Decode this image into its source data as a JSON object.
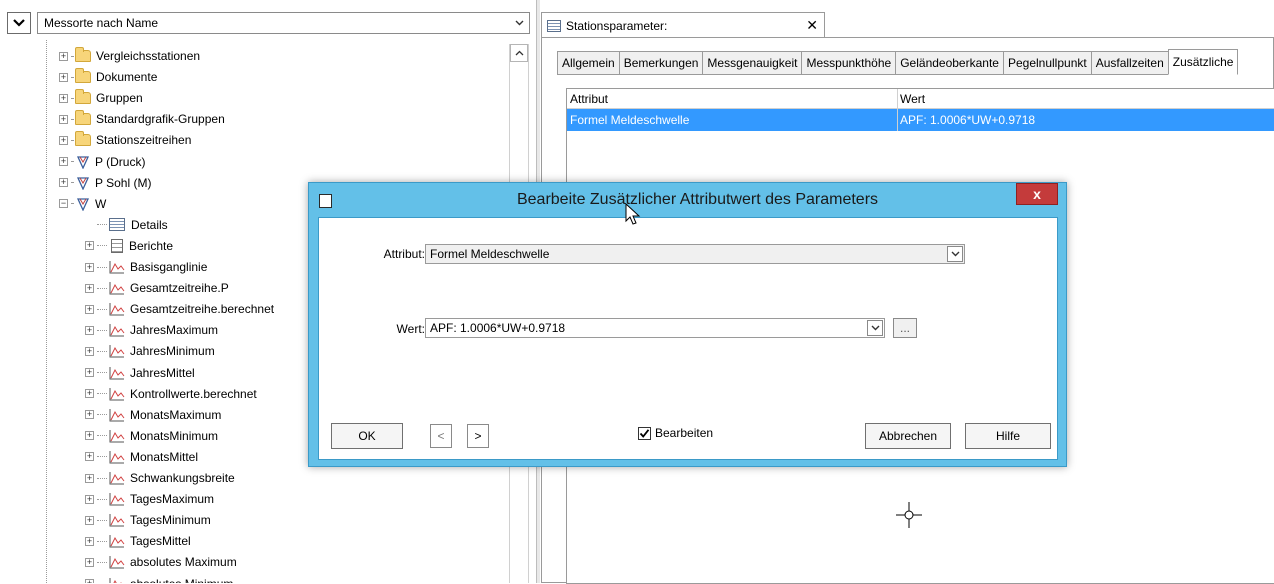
{
  "tree_view": {
    "selector_value": "Messorte nach Name",
    "items": [
      {
        "label": "Vergleichsstationen",
        "type": "folder",
        "level": 0,
        "expander": "+"
      },
      {
        "label": "Dokumente",
        "type": "folder",
        "level": 0,
        "expander": "+"
      },
      {
        "label": "Gruppen",
        "type": "folder",
        "level": 0,
        "expander": "+"
      },
      {
        "label": "Standardgrafik-Gruppen",
        "type": "folder",
        "level": 0,
        "expander": "+"
      },
      {
        "label": "Stationszeitreihen",
        "type": "folder",
        "level": 0,
        "expander": "+"
      },
      {
        "label": "P (Druck)",
        "type": "parameter",
        "level": 0,
        "expander": "+"
      },
      {
        "label": "P Sohl (M)",
        "type": "parameter",
        "level": 0,
        "expander": "+"
      },
      {
        "label": "W",
        "type": "parameter",
        "level": 0,
        "expander": "-"
      },
      {
        "label": "Details",
        "type": "table",
        "level": 1,
        "expander": ""
      },
      {
        "label": "Berichte",
        "type": "document",
        "level": 1,
        "expander": "+"
      },
      {
        "label": "Basisganglinie",
        "type": "timeseries",
        "level": 1,
        "expander": "+"
      },
      {
        "label": "Gesamtzeitreihe.P",
        "type": "timeseries",
        "level": 1,
        "expander": "+"
      },
      {
        "label": "Gesamtzeitreihe.berechnet",
        "type": "timeseries",
        "level": 1,
        "expander": "+"
      },
      {
        "label": "JahresMaximum",
        "type": "timeseries",
        "level": 1,
        "expander": "+"
      },
      {
        "label": "JahresMinimum",
        "type": "timeseries",
        "level": 1,
        "expander": "+"
      },
      {
        "label": "JahresMittel",
        "type": "timeseries",
        "level": 1,
        "expander": "+"
      },
      {
        "label": "Kontrollwerte.berechnet",
        "type": "timeseries",
        "level": 1,
        "expander": "+"
      },
      {
        "label": "MonatsMaximum",
        "type": "timeseries",
        "level": 1,
        "expander": "+"
      },
      {
        "label": "MonatsMinimum",
        "type": "timeseries",
        "level": 1,
        "expander": "+"
      },
      {
        "label": "MonatsMittel",
        "type": "timeseries",
        "level": 1,
        "expander": "+"
      },
      {
        "label": "Schwankungsbreite",
        "type": "timeseries",
        "level": 1,
        "expander": "+"
      },
      {
        "label": "TagesMaximum",
        "type": "timeseries",
        "level": 1,
        "expander": "+"
      },
      {
        "label": "TagesMinimum",
        "type": "timeseries",
        "level": 1,
        "expander": "+"
      },
      {
        "label": "TagesMittel",
        "type": "timeseries",
        "level": 1,
        "expander": "+"
      },
      {
        "label": "absolutes Maximum",
        "type": "timeseries",
        "level": 1,
        "expander": "+"
      },
      {
        "label": "absolutes Minimum",
        "type": "timeseries",
        "level": 1,
        "expander": "+"
      }
    ]
  },
  "station_panel": {
    "doc_tab_title": "Stationsparameter:",
    "tabs": [
      {
        "label": "Allgemein",
        "active": false
      },
      {
        "label": "Bemerkungen",
        "active": false
      },
      {
        "label": "Messgenauigkeit",
        "active": false
      },
      {
        "label": "Messpunkthöhe",
        "active": false
      },
      {
        "label": "Geländeoberkante",
        "active": false
      },
      {
        "label": "Pegelnullpunkt",
        "active": false
      },
      {
        "label": "Ausfallzeiten",
        "active": false
      },
      {
        "label": "Zusätzliche",
        "active": true
      }
    ],
    "grid": {
      "headers": {
        "attribute": "Attribut",
        "value": "Wert"
      },
      "rows": [
        {
          "attribute": "Formel Meldeschwelle",
          "value": "APF: 1.0006*UW+0.9718",
          "selected": true
        }
      ]
    }
  },
  "dialog": {
    "title": "Bearbeite Zusätzlicher Attributwert des Parameters",
    "close_label": "x",
    "attribute_label": "Attribut:",
    "attribute_value": "Formel Meldeschwelle",
    "value_label": "Wert:",
    "value_value": "APF: 1.0006*UW+0.9718",
    "ellipsis_label": "...",
    "ok_label": "OK",
    "prev_label": "<",
    "next_label": ">",
    "edit_checkbox_label": "Bearbeiten",
    "edit_checked": true,
    "cancel_label": "Abbrechen",
    "help_label": "Hilfe"
  },
  "colors": {
    "selection": "#3399ff",
    "dialog_frame": "#63c0e8",
    "close_button": "#c43b3b"
  }
}
